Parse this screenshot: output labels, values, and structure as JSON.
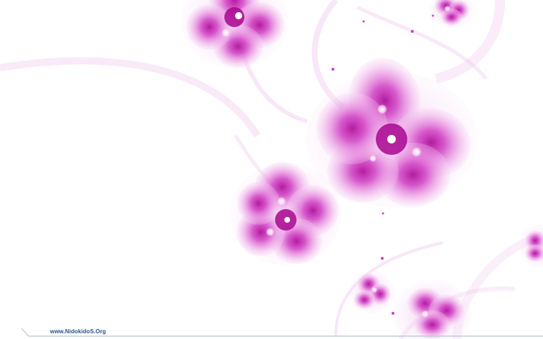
{
  "watermark": {
    "text": "www.NidokidoS.Org"
  },
  "colors": {
    "background": "#ffffff",
    "petal_light": "#f3c6ef",
    "petal_mid": "#e070d6",
    "petal_deep": "#b0109a",
    "swirl": "#eec4ea",
    "watermark_text": "#2a4f86"
  }
}
